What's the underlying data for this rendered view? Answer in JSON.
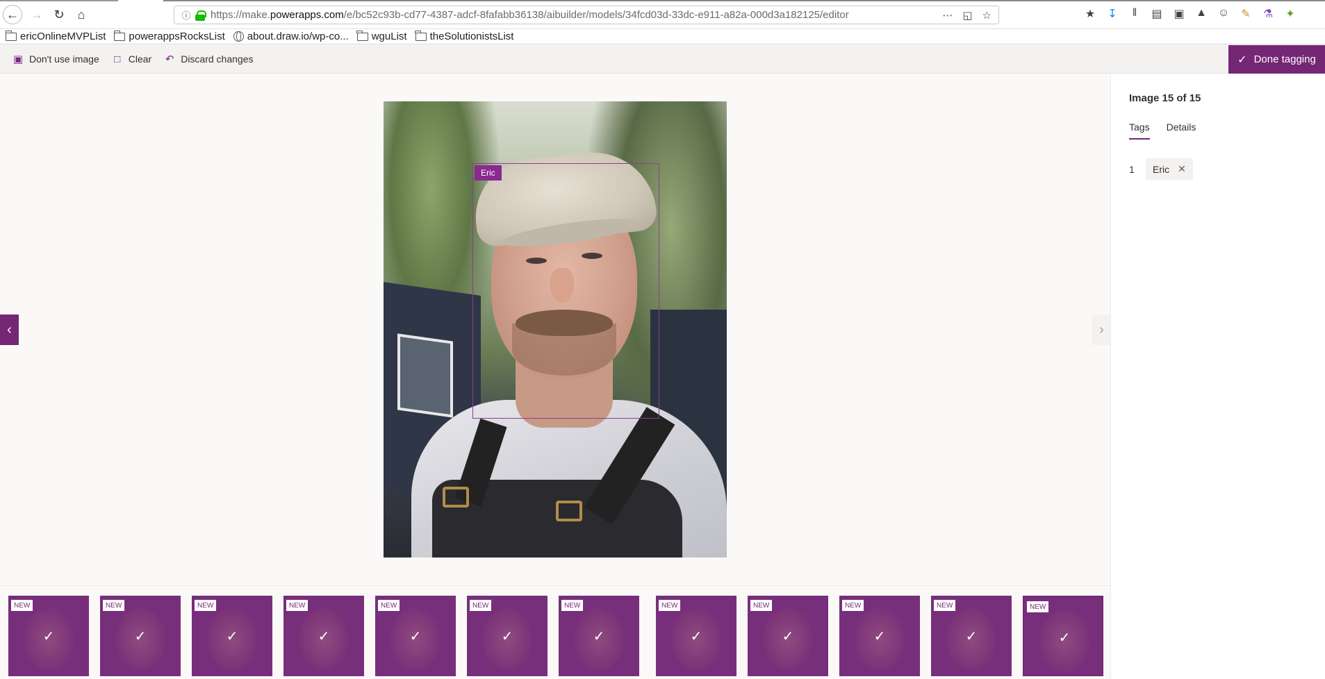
{
  "browser": {
    "url_prefix": "https://make.",
    "url_host": "powerapps.com",
    "url_path": "/e/bc52c93b-cd77-4387-adcf-8fafabb36138/aibuilder/models/34fcd03d-33dc-e911-a82a-000d3a182125/editor",
    "bookmarks": [
      {
        "label": "ericOnlineMVPList",
        "icon": "folder-icon"
      },
      {
        "label": "powerappsRocksList",
        "icon": "folder-icon"
      },
      {
        "label": "about.draw.io/wp-co...",
        "icon": "globe-icon"
      },
      {
        "label": "wguList",
        "icon": "folder-icon"
      },
      {
        "label": "theSolutionistsList",
        "icon": "folder-icon"
      }
    ]
  },
  "toolbar": {
    "dont_use_label": "Don't use image",
    "clear_label": "Clear",
    "discard_label": "Discard changes",
    "done_label": "Done tagging"
  },
  "canvas": {
    "bbox_tag": "Eric"
  },
  "panel": {
    "image_count": "Image 15 of 15",
    "tabs": [
      {
        "label": "Tags",
        "active": true
      },
      {
        "label": "Details",
        "active": false
      }
    ],
    "tags": [
      {
        "index": "1",
        "name": "Eric"
      }
    ]
  },
  "thumbnails": {
    "badge": "NEW",
    "items": [
      {
        "selected": false
      },
      {
        "selected": false
      },
      {
        "selected": false
      },
      {
        "selected": false
      },
      {
        "selected": false
      },
      {
        "selected": false
      },
      {
        "selected": false
      },
      {
        "selected": false
      },
      {
        "selected": false
      },
      {
        "selected": false
      },
      {
        "selected": false
      },
      {
        "selected": true
      }
    ]
  },
  "colors": {
    "accent": "#742774",
    "bbox": "#8e3c92",
    "tag_bg": "#f3f2f1"
  }
}
